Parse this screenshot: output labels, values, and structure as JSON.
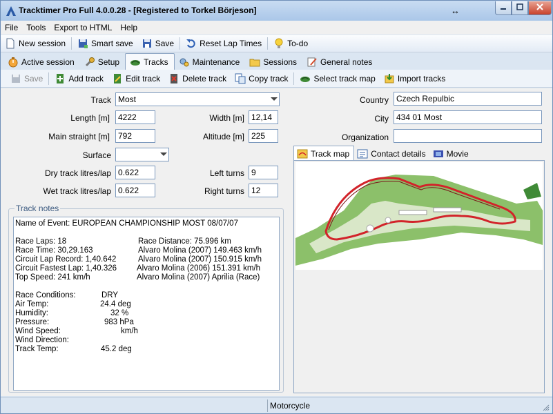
{
  "window": {
    "title": "Tracktimer Pro Full 4.0.0.28  -  [Registered to Torkel Börjeson]",
    "resize_glyph": "↔"
  },
  "menu": [
    "File",
    "Tools",
    "Export to HTML",
    "Help"
  ],
  "toolbar": {
    "new_session": "New session",
    "smart_save": "Smart save",
    "save": "Save",
    "reset_lap_times": "Reset Lap Times",
    "todo": "To-do"
  },
  "tabs": [
    {
      "label": "Active session",
      "icon": "stopwatch-icon"
    },
    {
      "label": "Setup",
      "icon": "wrench-icon"
    },
    {
      "label": "Tracks",
      "icon": "track-icon",
      "active": true
    },
    {
      "label": "Maintenance",
      "icon": "gears-icon"
    },
    {
      "label": "Sessions",
      "icon": "folder-icon"
    },
    {
      "label": "General notes",
      "icon": "notepad-icon"
    }
  ],
  "track_toolbar": {
    "save": "Save",
    "add_track": "Add track",
    "edit_track": "Edit track",
    "delete_track": "Delete track",
    "copy_track": "Copy track",
    "select_track_map": "Select track map",
    "import_tracks": "Import tracks"
  },
  "form": {
    "track_label": "Track",
    "track_value": "Most",
    "length_label": "Length [m]",
    "length_value": "4222",
    "width_label": "Width [m]",
    "width_value": "12,14",
    "main_straight_label": "Main straight [m]",
    "main_straight_value": "792",
    "altitude_label": "Altitude [m]",
    "altitude_value": "225",
    "surface_label": "Surface",
    "surface_value": "",
    "dry_label": "Dry track litres/lap",
    "dry_value": "0.622",
    "left_turns_label": "Left turns",
    "left_turns_value": "9",
    "wet_label": "Wet track litres/lap",
    "wet_value": "0.622",
    "right_turns_label": "Right turns",
    "right_turns_value": "12",
    "country_label": "Country",
    "country_value": "Czech Repulbic",
    "city_label": "City",
    "city_value": "434 01 Most",
    "organization_label": "Organization",
    "organization_value": ""
  },
  "notes": {
    "group_title": "Track notes",
    "lines": [
      [
        "Name of Event:  EUROPEAN CHAMPIONSHIP MOST     08/07/07"
      ],
      [],
      [
        "Race Laps:  18",
        "Race Distance:  75.996  km"
      ],
      [
        "Race Time:  30,29.163",
        "Alvaro Molina     (2007)  149.463  km/h"
      ],
      [
        "Circuit Lap Record:  1,40.642",
        "Alvaro Molina     (2007)  150.915  km/h"
      ],
      [
        "Circuit Fastest Lap:  1,40.326",
        "Alvaro Molina     (2006)  151.391  km/h"
      ],
      [
        "Top Speed:  241  km/h",
        "Alvaro Molina     (2007)  Aprilia     (Race)"
      ],
      [],
      [
        "Race Conditions:",
        "DRY"
      ],
      [
        "Air Temp:",
        "24.4  deg"
      ],
      [
        "Humidity:",
        "32  %"
      ],
      [
        "Pressure:",
        "983  hPa"
      ],
      [
        "Wind Speed:",
        "km/h"
      ],
      [
        "Wind Direction:"
      ],
      [
        "Track Temp:",
        "45.2  deg"
      ]
    ]
  },
  "right_tabs": [
    {
      "label": "Track map",
      "icon": "map-icon",
      "active": true
    },
    {
      "label": "Contact details",
      "icon": "card-icon"
    },
    {
      "label": "Movie",
      "icon": "film-icon"
    }
  ],
  "status": {
    "text": "Motorcycle"
  },
  "colors": {
    "accent": "#3c5a80",
    "track_red": "#d2232a",
    "grass": "#8cc06a"
  }
}
